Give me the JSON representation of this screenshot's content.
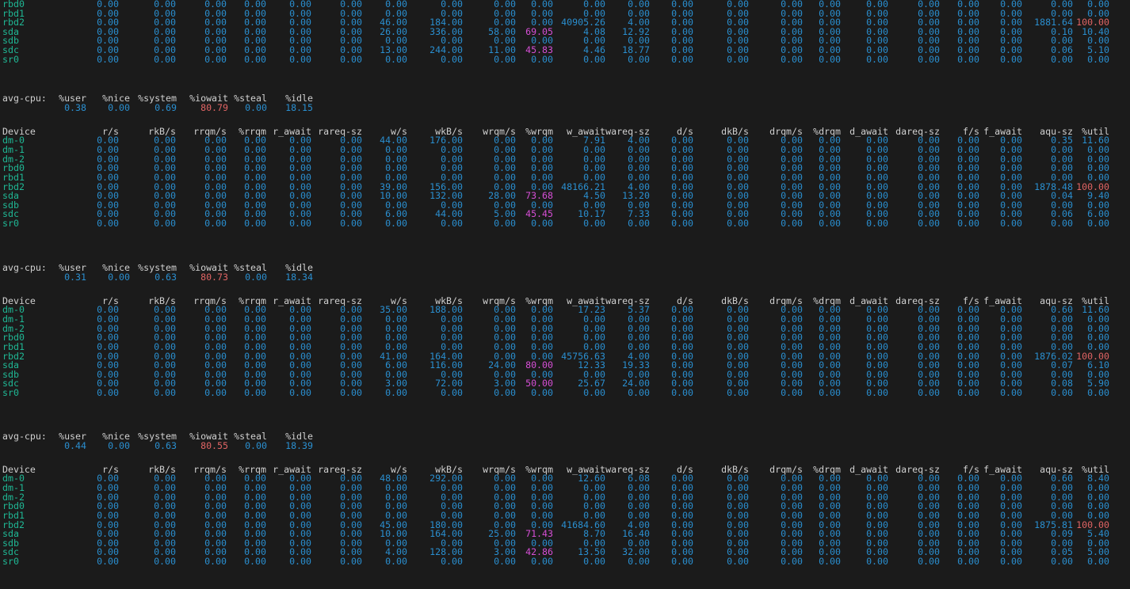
{
  "colors": {
    "background": "#1b1b1b",
    "header": "#d0d0d0",
    "device": "#1fb895",
    "number": "#2a8fd0",
    "util_high": "#e06464",
    "wrqm_high": "#d64fd6"
  },
  "columns": [
    "Device",
    "r/s",
    "rkB/s",
    "rrqm/s",
    "%rrqm",
    "r_await",
    "rareq-sz",
    "w/s",
    "wkB/s",
    "wrqm/s",
    "%wrqm",
    "w_await",
    "wareq-sz",
    "d/s",
    "dkB/s",
    "drqm/s",
    "%drqm",
    "d_await",
    "dareq-sz",
    "f/s",
    "f_await",
    "aqu-sz",
    "%util"
  ],
  "cpu_columns": [
    "avg-cpu:",
    "%user",
    "%nice",
    "%system",
    "%iowait",
    "%steal",
    "%idle"
  ],
  "top_partial": [
    [
      "rbd0",
      "0.00",
      "0.00",
      "0.00",
      "0.00",
      "0.00",
      "0.00",
      "0.00",
      "0.00",
      "0.00",
      "0.00",
      "0.00",
      "0.00",
      "0.00",
      "0.00",
      "0.00",
      "0.00",
      "0.00",
      "0.00",
      "0.00",
      "0.00",
      "0.00",
      "0.00"
    ],
    [
      "rbd1",
      "0.00",
      "0.00",
      "0.00",
      "0.00",
      "0.00",
      "0.00",
      "0.00",
      "0.00",
      "0.00",
      "0.00",
      "0.00",
      "0.00",
      "0.00",
      "0.00",
      "0.00",
      "0.00",
      "0.00",
      "0.00",
      "0.00",
      "0.00",
      "0.00",
      "0.00"
    ],
    [
      "rbd2",
      "0.00",
      "0.00",
      "0.00",
      "0.00",
      "0.00",
      "0.00",
      "46.00",
      "184.00",
      "0.00",
      "0.00",
      "40905.26",
      "4.00",
      "0.00",
      "0.00",
      "0.00",
      "0.00",
      "0.00",
      "0.00",
      "0.00",
      "0.00",
      "1881.64",
      "100.00"
    ],
    [
      "sda",
      "0.00",
      "0.00",
      "0.00",
      "0.00",
      "0.00",
      "0.00",
      "26.00",
      "336.00",
      "58.00",
      "69.05",
      "4.08",
      "12.92",
      "0.00",
      "0.00",
      "0.00",
      "0.00",
      "0.00",
      "0.00",
      "0.00",
      "0.00",
      "0.10",
      "10.40"
    ],
    [
      "sdb",
      "0.00",
      "0.00",
      "0.00",
      "0.00",
      "0.00",
      "0.00",
      "0.00",
      "0.00",
      "0.00",
      "0.00",
      "0.00",
      "0.00",
      "0.00",
      "0.00",
      "0.00",
      "0.00",
      "0.00",
      "0.00",
      "0.00",
      "0.00",
      "0.00",
      "0.00"
    ],
    [
      "sdc",
      "0.00",
      "0.00",
      "0.00",
      "0.00",
      "0.00",
      "0.00",
      "13.00",
      "244.00",
      "11.00",
      "45.83",
      "4.46",
      "18.77",
      "0.00",
      "0.00",
      "0.00",
      "0.00",
      "0.00",
      "0.00",
      "0.00",
      "0.00",
      "0.06",
      "5.10"
    ],
    [
      "sr0",
      "0.00",
      "0.00",
      "0.00",
      "0.00",
      "0.00",
      "0.00",
      "0.00",
      "0.00",
      "0.00",
      "0.00",
      "0.00",
      "0.00",
      "0.00",
      "0.00",
      "0.00",
      "0.00",
      "0.00",
      "0.00",
      "0.00",
      "0.00",
      "0.00",
      "0.00"
    ]
  ],
  "blocks": [
    {
      "cpu": [
        "0.38",
        "0.00",
        "0.69",
        "80.79",
        "0.00",
        "18.15"
      ],
      "rows": [
        [
          "dm-0",
          "0.00",
          "0.00",
          "0.00",
          "0.00",
          "0.00",
          "0.00",
          "44.00",
          "176.00",
          "0.00",
          "0.00",
          "7.91",
          "4.00",
          "0.00",
          "0.00",
          "0.00",
          "0.00",
          "0.00",
          "0.00",
          "0.00",
          "0.00",
          "0.35",
          "11.60"
        ],
        [
          "dm-1",
          "0.00",
          "0.00",
          "0.00",
          "0.00",
          "0.00",
          "0.00",
          "0.00",
          "0.00",
          "0.00",
          "0.00",
          "0.00",
          "0.00",
          "0.00",
          "0.00",
          "0.00",
          "0.00",
          "0.00",
          "0.00",
          "0.00",
          "0.00",
          "0.00",
          "0.00"
        ],
        [
          "dm-2",
          "0.00",
          "0.00",
          "0.00",
          "0.00",
          "0.00",
          "0.00",
          "0.00",
          "0.00",
          "0.00",
          "0.00",
          "0.00",
          "0.00",
          "0.00",
          "0.00",
          "0.00",
          "0.00",
          "0.00",
          "0.00",
          "0.00",
          "0.00",
          "0.00",
          "0.00"
        ],
        [
          "rbd0",
          "0.00",
          "0.00",
          "0.00",
          "0.00",
          "0.00",
          "0.00",
          "0.00",
          "0.00",
          "0.00",
          "0.00",
          "0.00",
          "0.00",
          "0.00",
          "0.00",
          "0.00",
          "0.00",
          "0.00",
          "0.00",
          "0.00",
          "0.00",
          "0.00",
          "0.00"
        ],
        [
          "rbd1",
          "0.00",
          "0.00",
          "0.00",
          "0.00",
          "0.00",
          "0.00",
          "0.00",
          "0.00",
          "0.00",
          "0.00",
          "0.00",
          "0.00",
          "0.00",
          "0.00",
          "0.00",
          "0.00",
          "0.00",
          "0.00",
          "0.00",
          "0.00",
          "0.00",
          "0.00"
        ],
        [
          "rbd2",
          "0.00",
          "0.00",
          "0.00",
          "0.00",
          "0.00",
          "0.00",
          "39.00",
          "156.00",
          "0.00",
          "0.00",
          "48166.21",
          "4.00",
          "0.00",
          "0.00",
          "0.00",
          "0.00",
          "0.00",
          "0.00",
          "0.00",
          "0.00",
          "1878.48",
          "100.00"
        ],
        [
          "sda",
          "0.00",
          "0.00",
          "0.00",
          "0.00",
          "0.00",
          "0.00",
          "10.00",
          "132.00",
          "28.00",
          "73.68",
          "4.50",
          "13.20",
          "0.00",
          "0.00",
          "0.00",
          "0.00",
          "0.00",
          "0.00",
          "0.00",
          "0.00",
          "0.04",
          "9.40"
        ],
        [
          "sdb",
          "0.00",
          "0.00",
          "0.00",
          "0.00",
          "0.00",
          "0.00",
          "0.00",
          "0.00",
          "0.00",
          "0.00",
          "0.00",
          "0.00",
          "0.00",
          "0.00",
          "0.00",
          "0.00",
          "0.00",
          "0.00",
          "0.00",
          "0.00",
          "0.00",
          "0.00"
        ],
        [
          "sdc",
          "0.00",
          "0.00",
          "0.00",
          "0.00",
          "0.00",
          "0.00",
          "6.00",
          "44.00",
          "5.00",
          "45.45",
          "10.17",
          "7.33",
          "0.00",
          "0.00",
          "0.00",
          "0.00",
          "0.00",
          "0.00",
          "0.00",
          "0.00",
          "0.06",
          "6.00"
        ],
        [
          "sr0",
          "0.00",
          "0.00",
          "0.00",
          "0.00",
          "0.00",
          "0.00",
          "0.00",
          "0.00",
          "0.00",
          "0.00",
          "0.00",
          "0.00",
          "0.00",
          "0.00",
          "0.00",
          "0.00",
          "0.00",
          "0.00",
          "0.00",
          "0.00",
          "0.00",
          "0.00"
        ]
      ]
    },
    {
      "cpu": [
        "0.31",
        "0.00",
        "0.63",
        "80.73",
        "0.00",
        "18.34"
      ],
      "rows": [
        [
          "dm-0",
          "0.00",
          "0.00",
          "0.00",
          "0.00",
          "0.00",
          "0.00",
          "35.00",
          "188.00",
          "0.00",
          "0.00",
          "17.23",
          "5.37",
          "0.00",
          "0.00",
          "0.00",
          "0.00",
          "0.00",
          "0.00",
          "0.00",
          "0.00",
          "0.60",
          "11.60"
        ],
        [
          "dm-1",
          "0.00",
          "0.00",
          "0.00",
          "0.00",
          "0.00",
          "0.00",
          "0.00",
          "0.00",
          "0.00",
          "0.00",
          "0.00",
          "0.00",
          "0.00",
          "0.00",
          "0.00",
          "0.00",
          "0.00",
          "0.00",
          "0.00",
          "0.00",
          "0.00",
          "0.00"
        ],
        [
          "dm-2",
          "0.00",
          "0.00",
          "0.00",
          "0.00",
          "0.00",
          "0.00",
          "0.00",
          "0.00",
          "0.00",
          "0.00",
          "0.00",
          "0.00",
          "0.00",
          "0.00",
          "0.00",
          "0.00",
          "0.00",
          "0.00",
          "0.00",
          "0.00",
          "0.00",
          "0.00"
        ],
        [
          "rbd0",
          "0.00",
          "0.00",
          "0.00",
          "0.00",
          "0.00",
          "0.00",
          "0.00",
          "0.00",
          "0.00",
          "0.00",
          "0.00",
          "0.00",
          "0.00",
          "0.00",
          "0.00",
          "0.00",
          "0.00",
          "0.00",
          "0.00",
          "0.00",
          "0.00",
          "0.00"
        ],
        [
          "rbd1",
          "0.00",
          "0.00",
          "0.00",
          "0.00",
          "0.00",
          "0.00",
          "0.00",
          "0.00",
          "0.00",
          "0.00",
          "0.00",
          "0.00",
          "0.00",
          "0.00",
          "0.00",
          "0.00",
          "0.00",
          "0.00",
          "0.00",
          "0.00",
          "0.00",
          "0.00"
        ],
        [
          "rbd2",
          "0.00",
          "0.00",
          "0.00",
          "0.00",
          "0.00",
          "0.00",
          "41.00",
          "164.00",
          "0.00",
          "0.00",
          "45756.63",
          "4.00",
          "0.00",
          "0.00",
          "0.00",
          "0.00",
          "0.00",
          "0.00",
          "0.00",
          "0.00",
          "1876.02",
          "100.00"
        ],
        [
          "sda",
          "0.00",
          "0.00",
          "0.00",
          "0.00",
          "0.00",
          "0.00",
          "6.00",
          "116.00",
          "24.00",
          "80.00",
          "12.33",
          "19.33",
          "0.00",
          "0.00",
          "0.00",
          "0.00",
          "0.00",
          "0.00",
          "0.00",
          "0.00",
          "0.07",
          "6.10"
        ],
        [
          "sdb",
          "0.00",
          "0.00",
          "0.00",
          "0.00",
          "0.00",
          "0.00",
          "0.00",
          "0.00",
          "0.00",
          "0.00",
          "0.00",
          "0.00",
          "0.00",
          "0.00",
          "0.00",
          "0.00",
          "0.00",
          "0.00",
          "0.00",
          "0.00",
          "0.00",
          "0.00"
        ],
        [
          "sdc",
          "0.00",
          "0.00",
          "0.00",
          "0.00",
          "0.00",
          "0.00",
          "3.00",
          "72.00",
          "3.00",
          "50.00",
          "25.67",
          "24.00",
          "0.00",
          "0.00",
          "0.00",
          "0.00",
          "0.00",
          "0.00",
          "0.00",
          "0.00",
          "0.08",
          "5.90"
        ],
        [
          "sr0",
          "0.00",
          "0.00",
          "0.00",
          "0.00",
          "0.00",
          "0.00",
          "0.00",
          "0.00",
          "0.00",
          "0.00",
          "0.00",
          "0.00",
          "0.00",
          "0.00",
          "0.00",
          "0.00",
          "0.00",
          "0.00",
          "0.00",
          "0.00",
          "0.00",
          "0.00"
        ]
      ]
    },
    {
      "cpu": [
        "0.44",
        "0.00",
        "0.63",
        "80.55",
        "0.00",
        "18.39"
      ],
      "rows": [
        [
          "dm-0",
          "0.00",
          "0.00",
          "0.00",
          "0.00",
          "0.00",
          "0.00",
          "48.00",
          "292.00",
          "0.00",
          "0.00",
          "12.60",
          "6.08",
          "0.00",
          "0.00",
          "0.00",
          "0.00",
          "0.00",
          "0.00",
          "0.00",
          "0.00",
          "0.60",
          "8.40"
        ],
        [
          "dm-1",
          "0.00",
          "0.00",
          "0.00",
          "0.00",
          "0.00",
          "0.00",
          "0.00",
          "0.00",
          "0.00",
          "0.00",
          "0.00",
          "0.00",
          "0.00",
          "0.00",
          "0.00",
          "0.00",
          "0.00",
          "0.00",
          "0.00",
          "0.00",
          "0.00",
          "0.00"
        ],
        [
          "dm-2",
          "0.00",
          "0.00",
          "0.00",
          "0.00",
          "0.00",
          "0.00",
          "0.00",
          "0.00",
          "0.00",
          "0.00",
          "0.00",
          "0.00",
          "0.00",
          "0.00",
          "0.00",
          "0.00",
          "0.00",
          "0.00",
          "0.00",
          "0.00",
          "0.00",
          "0.00"
        ],
        [
          "rbd0",
          "0.00",
          "0.00",
          "0.00",
          "0.00",
          "0.00",
          "0.00",
          "0.00",
          "0.00",
          "0.00",
          "0.00",
          "0.00",
          "0.00",
          "0.00",
          "0.00",
          "0.00",
          "0.00",
          "0.00",
          "0.00",
          "0.00",
          "0.00",
          "0.00",
          "0.00"
        ],
        [
          "rbd1",
          "0.00",
          "0.00",
          "0.00",
          "0.00",
          "0.00",
          "0.00",
          "0.00",
          "0.00",
          "0.00",
          "0.00",
          "0.00",
          "0.00",
          "0.00",
          "0.00",
          "0.00",
          "0.00",
          "0.00",
          "0.00",
          "0.00",
          "0.00",
          "0.00",
          "0.00"
        ],
        [
          "rbd2",
          "0.00",
          "0.00",
          "0.00",
          "0.00",
          "0.00",
          "0.00",
          "45.00",
          "180.00",
          "0.00",
          "0.00",
          "41684.60",
          "4.00",
          "0.00",
          "0.00",
          "0.00",
          "0.00",
          "0.00",
          "0.00",
          "0.00",
          "0.00",
          "1875.81",
          "100.00"
        ],
        [
          "sda",
          "0.00",
          "0.00",
          "0.00",
          "0.00",
          "0.00",
          "0.00",
          "10.00",
          "164.00",
          "25.00",
          "71.43",
          "8.70",
          "16.40",
          "0.00",
          "0.00",
          "0.00",
          "0.00",
          "0.00",
          "0.00",
          "0.00",
          "0.00",
          "0.09",
          "5.40"
        ],
        [
          "sdb",
          "0.00",
          "0.00",
          "0.00",
          "0.00",
          "0.00",
          "0.00",
          "0.00",
          "0.00",
          "0.00",
          "0.00",
          "0.00",
          "0.00",
          "0.00",
          "0.00",
          "0.00",
          "0.00",
          "0.00",
          "0.00",
          "0.00",
          "0.00",
          "0.00",
          "0.00"
        ],
        [
          "sdc",
          "0.00",
          "0.00",
          "0.00",
          "0.00",
          "0.00",
          "0.00",
          "4.00",
          "128.00",
          "3.00",
          "42.86",
          "13.50",
          "32.00",
          "0.00",
          "0.00",
          "0.00",
          "0.00",
          "0.00",
          "0.00",
          "0.00",
          "0.00",
          "0.05",
          "5.00"
        ],
        [
          "sr0",
          "0.00",
          "0.00",
          "0.00",
          "0.00",
          "0.00",
          "0.00",
          "0.00",
          "0.00",
          "0.00",
          "0.00",
          "0.00",
          "0.00",
          "0.00",
          "0.00",
          "0.00",
          "0.00",
          "0.00",
          "0.00",
          "0.00",
          "0.00",
          "0.00",
          "0.00"
        ]
      ]
    }
  ]
}
